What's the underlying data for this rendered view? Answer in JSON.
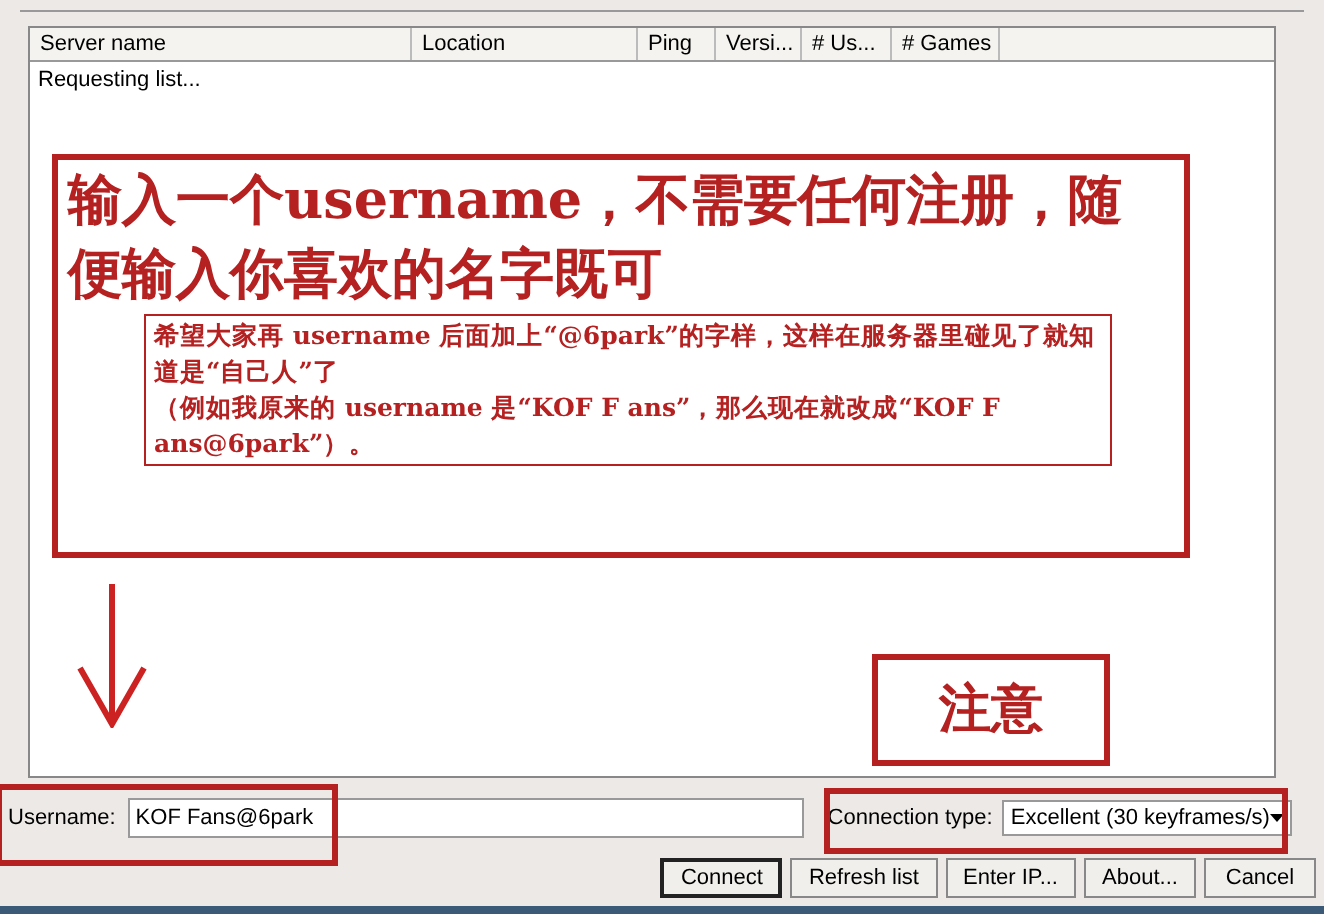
{
  "list": {
    "columns": [
      {
        "label": "Server name"
      },
      {
        "label": "Location"
      },
      {
        "label": "Ping"
      },
      {
        "label": "Versi..."
      },
      {
        "label": "# Us..."
      },
      {
        "label": "# Games"
      }
    ],
    "status_text": "Requesting list..."
  },
  "annotations": {
    "heading": "输入一个username，不需要任何注册，随便输入你喜欢的名字既可",
    "note": [
      "希望大家再 username 后面加上“@6park”的字样，这样在服务器里碰见了就知道是“自己人”了",
      "（例如我原来的 username 是“KOF F ans”，那么现在就改成“KOF F ans@6park”）。"
    ],
    "callout": "注意"
  },
  "username": {
    "label": "Username:",
    "value": "KOF Fans@6park"
  },
  "connection": {
    "label": "Connection type:",
    "value": "Excellent (30 keyframes/s)"
  },
  "buttons": [
    {
      "label": "Connect",
      "default": true
    },
    {
      "label": "Refresh list",
      "default": false
    },
    {
      "label": "Enter IP...",
      "default": false
    },
    {
      "label": "About...",
      "default": false
    },
    {
      "label": "Cancel",
      "default": false
    }
  ]
}
